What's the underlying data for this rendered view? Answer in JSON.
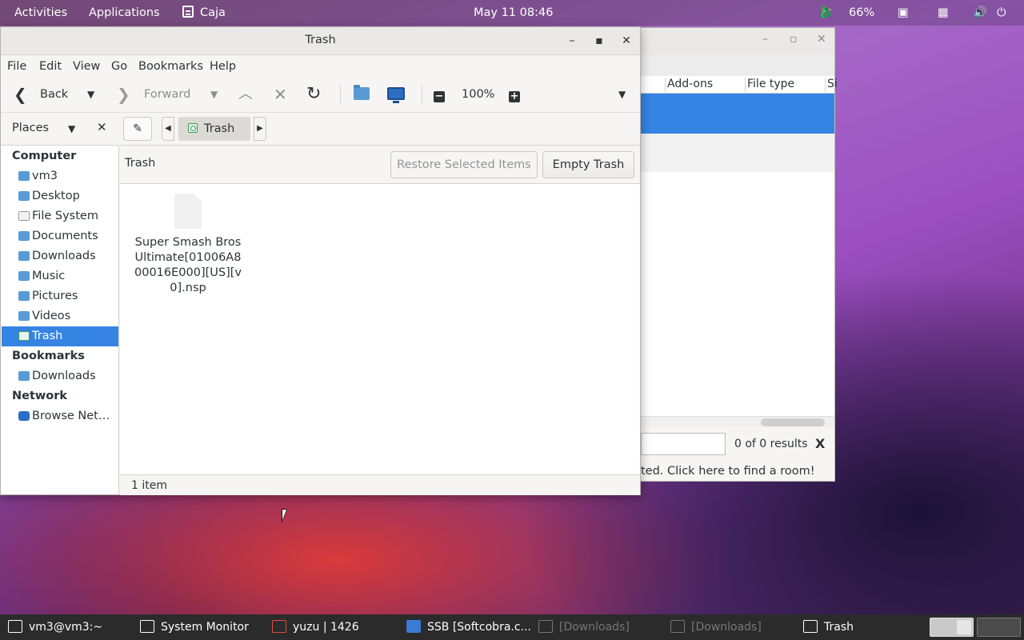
{
  "topbar": {
    "activities": "Activities",
    "applications": "Applications",
    "current_app": "Caja",
    "clock": "May 11  08:46",
    "battery": "66%"
  },
  "background_window": {
    "columns": [
      "Add-ons",
      "File type",
      "Si"
    ],
    "results": "0 of 0 results",
    "close_search": "X",
    "status": "ted. Click here to find a room!"
  },
  "window": {
    "title": "Trash",
    "menu": [
      "File",
      "Edit",
      "View",
      "Go",
      "Bookmarks",
      "Help"
    ],
    "toolbar": {
      "back": "Back",
      "forward": "Forward",
      "zoom": "100%"
    },
    "pathbar": {
      "places": "Places",
      "current": "Trash"
    },
    "sidebar": {
      "computer_header": "Computer",
      "computer_items": [
        "vm3",
        "Desktop",
        "File System",
        "Documents",
        "Downloads",
        "Music",
        "Pictures",
        "Videos",
        "Trash"
      ],
      "bookmarks_header": "Bookmarks",
      "bookmark_items": [
        "Downloads"
      ],
      "network_header": "Network",
      "network_items": [
        "Browse Netw…"
      ]
    },
    "infobar": {
      "label": "Trash",
      "restore": "Restore Selected Items",
      "empty": "Empty Trash"
    },
    "files": [
      {
        "name": "Super Smash Bros Ultimate[01006A800016E000][US][v0].nsp"
      }
    ],
    "status": "1 item"
  },
  "taskbar": {
    "items": [
      "vm3@vm3:~",
      "System Monitor",
      "yuzu | 1426",
      "SSB [Softcobra.c...",
      "[Downloads]",
      "[Downloads]",
      "Trash"
    ]
  }
}
